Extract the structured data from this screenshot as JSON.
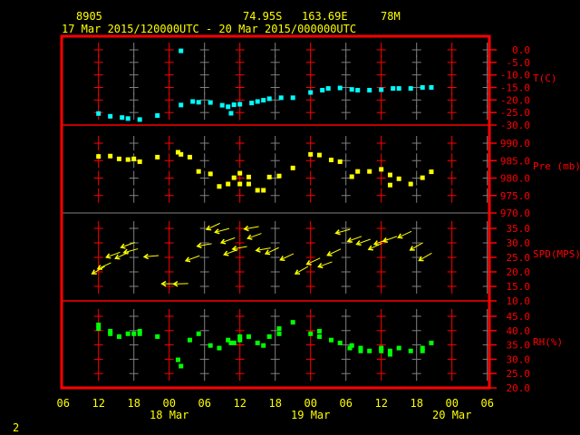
{
  "header": {
    "station": "8905",
    "latitude": "74.95S",
    "longitude": "163.69E",
    "elevation": "78M",
    "period": "17 Mar 2015/120000UTC - 20 Mar 2015/000000UTC"
  },
  "footer": {
    "page": "2"
  },
  "colors": {
    "axis": "#ff0000",
    "grid_minor": "#808080",
    "text": "#ffff00",
    "temperature": "#00ffff",
    "pressure": "#ffff00",
    "wind": "#ffff00",
    "humidity": "#00ff00"
  },
  "x_axis": {
    "ticks": [
      {
        "time": "17 Mar 06:00",
        "label": "06"
      },
      {
        "time": "17 Mar 12:00",
        "label": "12"
      },
      {
        "time": "17 Mar 18:00",
        "label": "18"
      },
      {
        "time": "18 Mar 00:00",
        "label": "00"
      },
      {
        "time": "18 Mar 06:00",
        "label": "06"
      },
      {
        "time": "18 Mar 12:00",
        "label": "12"
      },
      {
        "time": "18 Mar 18:00",
        "label": "18"
      },
      {
        "time": "19 Mar 00:00",
        "label": "00"
      },
      {
        "time": "19 Mar 06:00",
        "label": "06"
      },
      {
        "time": "19 Mar 12:00",
        "label": "12"
      },
      {
        "time": "19 Mar 18:00",
        "label": "18"
      },
      {
        "time": "20 Mar 00:00",
        "label": "00"
      },
      {
        "time": "20 Mar 06:00",
        "label": "06"
      }
    ],
    "dates": [
      {
        "time": "18 Mar 00:00",
        "label": "18 Mar"
      },
      {
        "time": "19 Mar 00:00",
        "label": "19 Mar"
      },
      {
        "time": "20 Mar 00:00",
        "label": "20 Mar"
      }
    ],
    "range": [
      "17 Mar 06:00",
      "20 Mar 06:00"
    ]
  },
  "chart_data": [
    {
      "type": "scatter",
      "ylabel": "T(C)",
      "ylim": [
        -30,
        0
      ],
      "yticks": [
        "0.0",
        "-5.0",
        "-10.0",
        "-15.0",
        "-20.0",
        "-25.0",
        "-30.0"
      ],
      "points": [
        [
          "17 Mar 12:00",
          -25.4
        ],
        [
          "17 Mar 14:00",
          -26.5
        ],
        [
          "17 Mar 16:00",
          -27.0
        ],
        [
          "17 Mar 17:00",
          -27.4
        ],
        [
          "17 Mar 19:00",
          -27.8
        ],
        [
          "17 Mar 22:00",
          -26.2
        ],
        [
          "18 Mar 02:00",
          -0.4
        ],
        [
          "18 Mar 02:00",
          -22.0
        ],
        [
          "18 Mar 04:00",
          -20.6
        ],
        [
          "18 Mar 05:00",
          -20.9
        ],
        [
          "18 Mar 07:00",
          -21.0
        ],
        [
          "18 Mar 09:00",
          -22.1
        ],
        [
          "18 Mar 10:00",
          -22.7
        ],
        [
          "18 Mar 10:30",
          -25.3
        ],
        [
          "18 Mar 11:00",
          -21.9
        ],
        [
          "18 Mar 12:00",
          -21.7
        ],
        [
          "18 Mar 14:00",
          -21.2
        ],
        [
          "18 Mar 15:00",
          -20.6
        ],
        [
          "18 Mar 16:00",
          -20.1
        ],
        [
          "18 Mar 17:00",
          -19.5
        ],
        [
          "18 Mar 19:00",
          -19.1
        ],
        [
          "18 Mar 21:00",
          -19.1
        ],
        [
          "19 Mar 00:00",
          -17.0
        ],
        [
          "19 Mar 02:00",
          -16.1
        ],
        [
          "19 Mar 03:00",
          -15.4
        ],
        [
          "19 Mar 05:00",
          -15.2
        ],
        [
          "19 Mar 07:00",
          -15.8
        ],
        [
          "19 Mar 08:00",
          -16.1
        ],
        [
          "19 Mar 10:00",
          -16.1
        ],
        [
          "19 Mar 12:00",
          -15.9
        ],
        [
          "19 Mar 14:00",
          -15.4
        ],
        [
          "19 Mar 15:00",
          -15.4
        ],
        [
          "19 Mar 17:00",
          -15.4
        ],
        [
          "19 Mar 19:00",
          -15.0
        ],
        [
          "19 Mar 20:30",
          -15.0
        ]
      ]
    },
    {
      "type": "scatter",
      "ylabel": "Pre (mb)",
      "ylim": [
        970,
        990
      ],
      "yticks": [
        "990.0",
        "985.0",
        "980.0",
        "975.0",
        "970.0"
      ],
      "points": [
        [
          "17 Mar 12:00",
          986.2
        ],
        [
          "17 Mar 14:00",
          986.3
        ],
        [
          "17 Mar 15:30",
          985.5
        ],
        [
          "17 Mar 17:00",
          985.3
        ],
        [
          "17 Mar 18:00",
          985.5
        ],
        [
          "17 Mar 19:00",
          984.7
        ],
        [
          "17 Mar 22:00",
          986.0
        ],
        [
          "18 Mar 01:30",
          987.4
        ],
        [
          "18 Mar 02:00",
          986.8
        ],
        [
          "18 Mar 03:30",
          986.0
        ],
        [
          "18 Mar 05:00",
          981.9
        ],
        [
          "18 Mar 07:00",
          981.2
        ],
        [
          "18 Mar 08:30",
          977.6
        ],
        [
          "18 Mar 10:00",
          978.3
        ],
        [
          "18 Mar 11:00",
          980.1
        ],
        [
          "18 Mar 12:00",
          981.4
        ],
        [
          "18 Mar 12:00",
          978.3
        ],
        [
          "18 Mar 13:30",
          978.3
        ],
        [
          "18 Mar 13:30",
          980.3
        ],
        [
          "18 Mar 15:00",
          976.5
        ],
        [
          "18 Mar 16:00",
          976.5
        ],
        [
          "18 Mar 17:00",
          980.3
        ],
        [
          "18 Mar 18:40",
          980.6
        ],
        [
          "18 Mar 21:00",
          982.9
        ],
        [
          "19 Mar 00:00",
          986.8
        ],
        [
          "19 Mar 01:30",
          986.6
        ],
        [
          "19 Mar 03:30",
          985.2
        ],
        [
          "19 Mar 05:00",
          984.7
        ],
        [
          "19 Mar 07:00",
          980.4
        ],
        [
          "19 Mar 08:00",
          981.9
        ],
        [
          "19 Mar 10:00",
          981.9
        ],
        [
          "19 Mar 12:00",
          982.5
        ],
        [
          "19 Mar 13:30",
          980.9
        ],
        [
          "19 Mar 13:30",
          978.0
        ],
        [
          "19 Mar 15:00",
          979.8
        ],
        [
          "19 Mar 17:00",
          978.3
        ],
        [
          "19 Mar 19:00",
          980.1
        ],
        [
          "19 Mar 20:30",
          981.8
        ]
      ]
    },
    {
      "type": "wind-arrows",
      "ylabel": "SPD(MPS)",
      "ylim": [
        10,
        35
      ],
      "yticks": [
        "35.0",
        "30.0",
        "25.0",
        "20.0",
        "15.0",
        "10.0"
      ],
      "points": [
        {
          "time": "17 Mar 12:00",
          "speed": 20.6,
          "dir": 60
        },
        {
          "time": "17 Mar 13:00",
          "speed": 22.1,
          "dir": 65
        },
        {
          "time": "17 Mar 14:30",
          "speed": 25.9,
          "dir": 70
        },
        {
          "time": "17 Mar 16:00",
          "speed": 25.7,
          "dir": 65
        },
        {
          "time": "17 Mar 17:00",
          "speed": 29.3,
          "dir": 70
        },
        {
          "time": "17 Mar 17:30",
          "speed": 27.3,
          "dir": 75
        },
        {
          "time": "17 Mar 21:00",
          "speed": 25.4,
          "dir": 85
        },
        {
          "time": "18 Mar 00:00",
          "speed": 15.9,
          "dir": 90
        },
        {
          "time": "18 Mar 02:00",
          "speed": 15.9,
          "dir": 88
        },
        {
          "time": "18 Mar 04:00",
          "speed": 24.7,
          "dir": 70
        },
        {
          "time": "18 Mar 06:00",
          "speed": 29.3,
          "dir": 80
        },
        {
          "time": "18 Mar 07:30",
          "speed": 35.7,
          "dir": 65
        },
        {
          "time": "18 Mar 09:00",
          "speed": 34.3,
          "dir": 75
        },
        {
          "time": "18 Mar 10:00",
          "speed": 30.9,
          "dir": 70
        },
        {
          "time": "18 Mar 10:30",
          "speed": 26.8,
          "dir": 70
        },
        {
          "time": "18 Mar 12:00",
          "speed": 28.3,
          "dir": 80
        },
        {
          "time": "18 Mar 14:00",
          "speed": 35.2,
          "dir": 80
        },
        {
          "time": "18 Mar 14:30",
          "speed": 32.4,
          "dir": 70
        },
        {
          "time": "18 Mar 16:00",
          "speed": 27.8,
          "dir": 80
        },
        {
          "time": "18 Mar 17:30",
          "speed": 27.3,
          "dir": 65
        },
        {
          "time": "18 Mar 20:00",
          "speed": 25.2,
          "dir": 65
        },
        {
          "time": "18 Mar 22:30",
          "speed": 20.6,
          "dir": 60
        },
        {
          "time": "19 Mar 00:30",
          "speed": 23.7,
          "dir": 65
        },
        {
          "time": "19 Mar 02:30",
          "speed": 22.6,
          "dir": 70
        },
        {
          "time": "19 Mar 04:00",
          "speed": 26.8,
          "dir": 65
        },
        {
          "time": "19 Mar 05:30",
          "speed": 34.0,
          "dir": 75
        },
        {
          "time": "19 Mar 07:30",
          "speed": 31.4,
          "dir": 70
        },
        {
          "time": "19 Mar 09:00",
          "speed": 30.4,
          "dir": 70
        },
        {
          "time": "19 Mar 11:00",
          "speed": 28.8,
          "dir": 65
        },
        {
          "time": "19 Mar 12:00",
          "speed": 30.4,
          "dir": 70
        },
        {
          "time": "19 Mar 13:30",
          "speed": 31.4,
          "dir": 70
        },
        {
          "time": "19 Mar 16:00",
          "speed": 32.9,
          "dir": 65
        },
        {
          "time": "19 Mar 18:00",
          "speed": 28.8,
          "dir": 60
        },
        {
          "time": "19 Mar 19:30",
          "speed": 25.2,
          "dir": 60
        }
      ]
    },
    {
      "type": "scatter",
      "ylabel": "RH(%)",
      "ylim": [
        20,
        45
      ],
      "yticks": [
        "45.0",
        "40.0",
        "35.0",
        "30.0",
        "25.0",
        "20.0"
      ],
      "points": [
        [
          "17 Mar 12:00",
          42.0
        ],
        [
          "17 Mar 12:00",
          40.7
        ],
        [
          "17 Mar 14:00",
          39.8
        ],
        [
          "17 Mar 14:00",
          38.9
        ],
        [
          "17 Mar 15:30",
          37.9
        ],
        [
          "17 Mar 17:00",
          38.9
        ],
        [
          "17 Mar 18:00",
          38.9
        ],
        [
          "17 Mar 19:00",
          38.9
        ],
        [
          "17 Mar 19:00",
          39.8
        ],
        [
          "17 Mar 22:00",
          37.9
        ],
        [
          "18 Mar 01:30",
          29.8
        ],
        [
          "18 Mar 02:00",
          27.6
        ],
        [
          "18 Mar 03:30",
          36.7
        ],
        [
          "18 Mar 05:00",
          38.9
        ],
        [
          "18 Mar 07:00",
          34.8
        ],
        [
          "18 Mar 08:30",
          33.9
        ],
        [
          "18 Mar 10:00",
          36.7
        ],
        [
          "18 Mar 10:30",
          35.7
        ],
        [
          "18 Mar 11:00",
          35.7
        ],
        [
          "18 Mar 12:00",
          36.7
        ],
        [
          "18 Mar 12:00",
          37.9
        ],
        [
          "18 Mar 13:30",
          37.9
        ],
        [
          "18 Mar 15:00",
          35.7
        ],
        [
          "18 Mar 16:00",
          34.8
        ],
        [
          "18 Mar 17:00",
          37.9
        ],
        [
          "18 Mar 18:40",
          38.9
        ],
        [
          "18 Mar 18:40",
          40.7
        ],
        [
          "18 Mar 21:00",
          42.9
        ],
        [
          "19 Mar 00:00",
          38.9
        ],
        [
          "19 Mar 01:30",
          37.9
        ],
        [
          "19 Mar 01:30",
          39.8
        ],
        [
          "19 Mar 03:30",
          36.7
        ],
        [
          "19 Mar 05:00",
          35.7
        ],
        [
          "19 Mar 06:40",
          33.9
        ],
        [
          "19 Mar 07:00",
          34.8
        ],
        [
          "19 Mar 08:30",
          32.9
        ],
        [
          "19 Mar 08:30",
          33.9
        ],
        [
          "19 Mar 10:00",
          32.9
        ],
        [
          "19 Mar 12:00",
          32.9
        ],
        [
          "19 Mar 12:00",
          33.9
        ],
        [
          "19 Mar 13:30",
          31.7
        ],
        [
          "19 Mar 13:30",
          32.9
        ],
        [
          "19 Mar 15:00",
          33.9
        ],
        [
          "19 Mar 17:00",
          32.9
        ],
        [
          "19 Mar 19:00",
          32.9
        ],
        [
          "19 Mar 19:00",
          33.9
        ],
        [
          "19 Mar 20:30",
          35.7
        ]
      ]
    }
  ]
}
